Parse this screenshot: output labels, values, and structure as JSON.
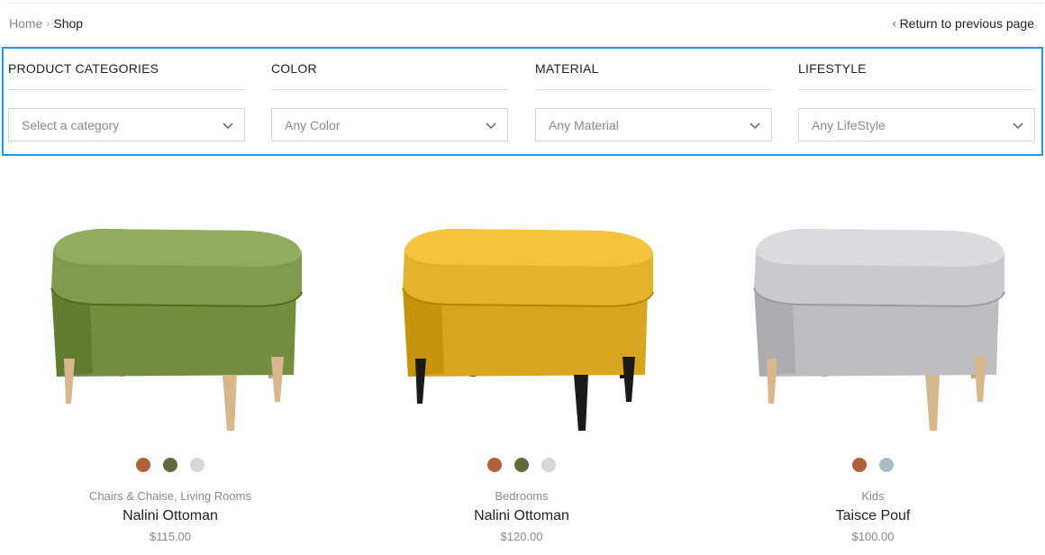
{
  "breadcrumb": {
    "home": "Home",
    "current": "Shop"
  },
  "return_link": "Return to previous page",
  "filters": [
    {
      "label": "PRODUCT CATEGORIES",
      "value": "Select a category"
    },
    {
      "label": "COLOR",
      "value": "Any Color"
    },
    {
      "label": "MATERIAL",
      "value": "Any Material"
    },
    {
      "label": "LIFESTYLE",
      "value": "Any LifeStyle"
    }
  ],
  "colors": {
    "accent": "#1e9be3"
  },
  "products": [
    {
      "image": "green-ottoman",
      "upholstery": "#7f9a4a",
      "legs": "#d7b88e",
      "swatches": [
        "#b0603a",
        "#5d6b3c",
        "#d8d8d8"
      ],
      "category": "Chairs & Chaise, Living Rooms",
      "name": "Nalini Ottoman",
      "price": "$115.00"
    },
    {
      "image": "yellow-ottoman",
      "upholstery": "#e4b22a",
      "legs": "#1a1a1a",
      "swatches": [
        "#b0603a",
        "#5d6b3c",
        "#d8d8d8"
      ],
      "category": "Bedrooms",
      "name": "Nalini Ottoman",
      "price": "$120.00"
    },
    {
      "image": "grey-pouf",
      "upholstery": "#c9cacd",
      "legs": "#d7b88e",
      "swatches": [
        "#b0603a",
        "#a9bcc7"
      ],
      "category": "Kids",
      "name": "Taisce Pouf",
      "price": "$100.00"
    }
  ]
}
